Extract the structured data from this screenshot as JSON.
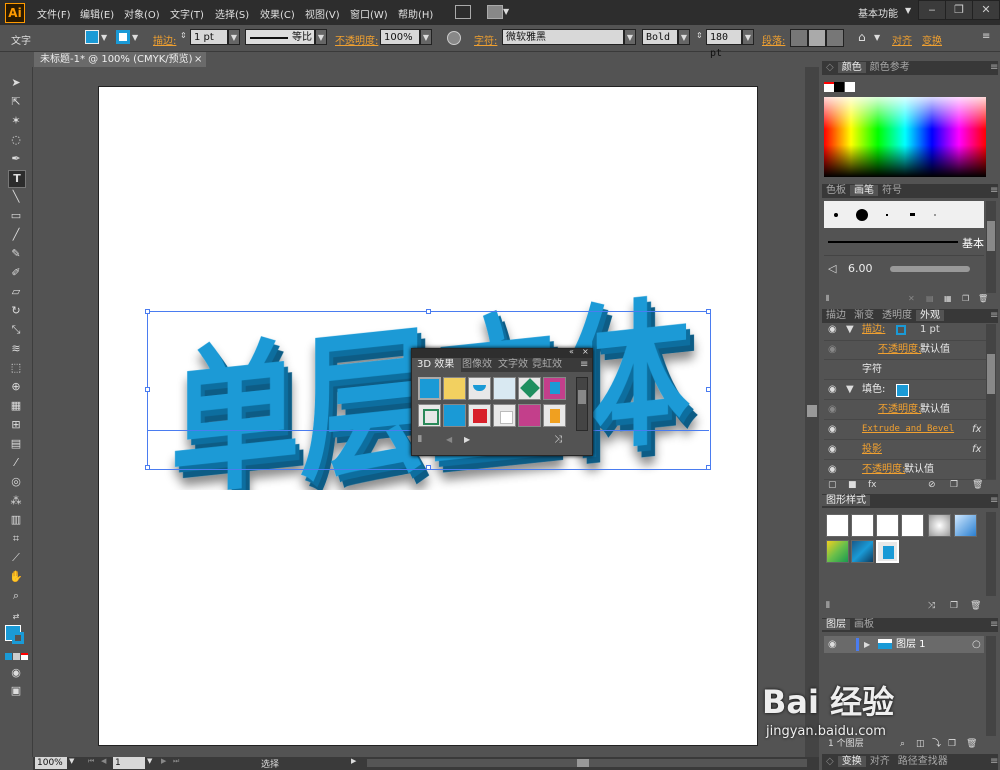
{
  "app": {
    "logo": "Ai",
    "workspace": "基本功能"
  },
  "menu": [
    "文件(F)",
    "编辑(E)",
    "对象(O)",
    "文字(T)",
    "选择(S)",
    "效果(C)",
    "视图(V)",
    "窗口(W)",
    "帮助(H)"
  ],
  "window_buttons": [
    "‒",
    "❐",
    "✕"
  ],
  "control": {
    "tool_name": "文字",
    "stroke_label": "描边:",
    "stroke_value": "1 pt",
    "profile_label": "等比",
    "opacity_label": "不透明度:",
    "opacity_value": "100%",
    "char_label": "字符:",
    "font_value": "微软雅黑",
    "style_value": "Bold",
    "size_value": "180 pt",
    "para_label": "段落:",
    "align_label": "对齐",
    "transform_label": "变换"
  },
  "doc_tab": {
    "title": "未标题-1* @ 100% (CMYK/预览)",
    "close": "×"
  },
  "canvas": {
    "text": "单层立体"
  },
  "float_panel": {
    "tabs": [
      "3D 效果",
      "图像效",
      "文字效",
      "霓虹效"
    ],
    "menu_icon": "≡"
  },
  "panels": {
    "color": {
      "tabs": [
        "颜色",
        "颜色参考"
      ]
    },
    "brushes": {
      "tabs": [
        "色板",
        "画笔",
        "符号"
      ],
      "basic_label": "基本",
      "size_value": "6.00"
    },
    "appearance": {
      "tabs": [
        "描边",
        "渐变",
        "透明度",
        "外观"
      ],
      "rows": [
        {
          "label": "描边:",
          "value": "1 pt",
          "fx": ""
        },
        {
          "label": "不透明度:",
          "value": "默认值",
          "fx": ""
        },
        {
          "label": "字符",
          "value": "",
          "fx": ""
        },
        {
          "label": "填色:",
          "value": "",
          "fx": ""
        },
        {
          "label": "不透明度:",
          "value": "默认值",
          "fx": ""
        },
        {
          "label": "Extrude and Bevel",
          "value": "",
          "fx": "fx"
        },
        {
          "label": "投影",
          "value": "",
          "fx": "fx"
        },
        {
          "label": "不透明度:",
          "value": "默认值",
          "fx": ""
        }
      ]
    },
    "graphic_styles": {
      "tabs": [
        "图形样式"
      ]
    },
    "layers": {
      "tabs": [
        "图层",
        "画板"
      ],
      "layer_name": "图层 1",
      "count_label": "1 个图层"
    },
    "bottom_tabs": [
      "变换",
      "对齐",
      "路径查找器"
    ]
  },
  "status": {
    "zoom": "100%",
    "page": "1",
    "mode": "选择"
  },
  "watermark": {
    "brand": "Bai 经验",
    "url": "jingyan.baidu.com"
  },
  "colors": {
    "accent_blue": "#1a9ad6",
    "orange_label": "#f0a030"
  }
}
